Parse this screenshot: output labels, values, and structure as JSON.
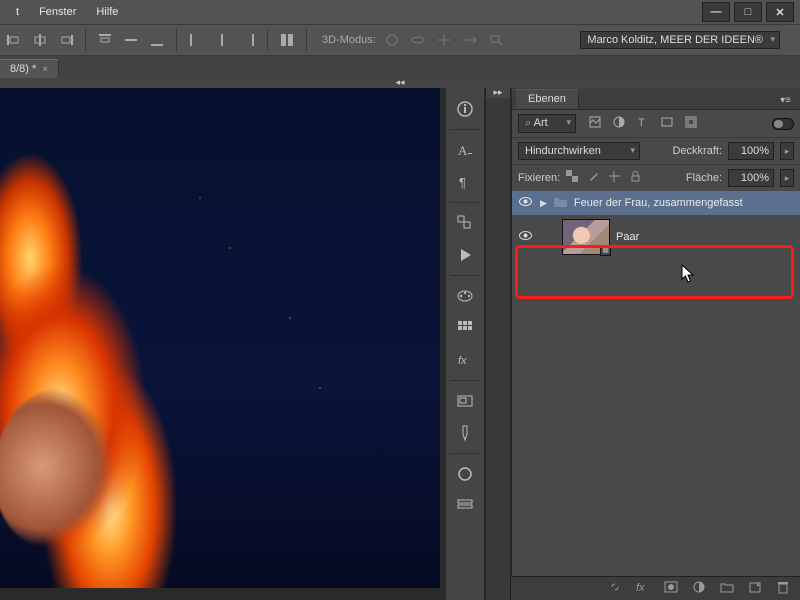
{
  "menubar": {
    "file_partial": "t",
    "window": "Fenster",
    "help": "Hilfe"
  },
  "window_controls": {
    "minimize": "—",
    "maximize": "□",
    "close": "✕"
  },
  "toolbar": {
    "mode3d_label": "3D-Modus:",
    "credit": "Marco Kolditz, MEER DER IDEEN®"
  },
  "tab": {
    "title": "8/8) *"
  },
  "panel": {
    "title": "Ebenen",
    "filter_label": "Art",
    "blend_mode": "Hindurchwirken",
    "opacity_label": "Deckkraft:",
    "opacity_value": "100%",
    "lock_label": "Fixieren:",
    "fill_label": "Fläche:",
    "fill_value": "100%"
  },
  "layers": {
    "group_name": "Feuer der Frau, zusammengefasst",
    "layer2_name": "Paar"
  },
  "footer_icons": {
    "link": "⬘",
    "fx": "fx",
    "mask": "◐",
    "adjust": "◑",
    "group": "▭",
    "new": "▭",
    "trash": "🗑"
  }
}
